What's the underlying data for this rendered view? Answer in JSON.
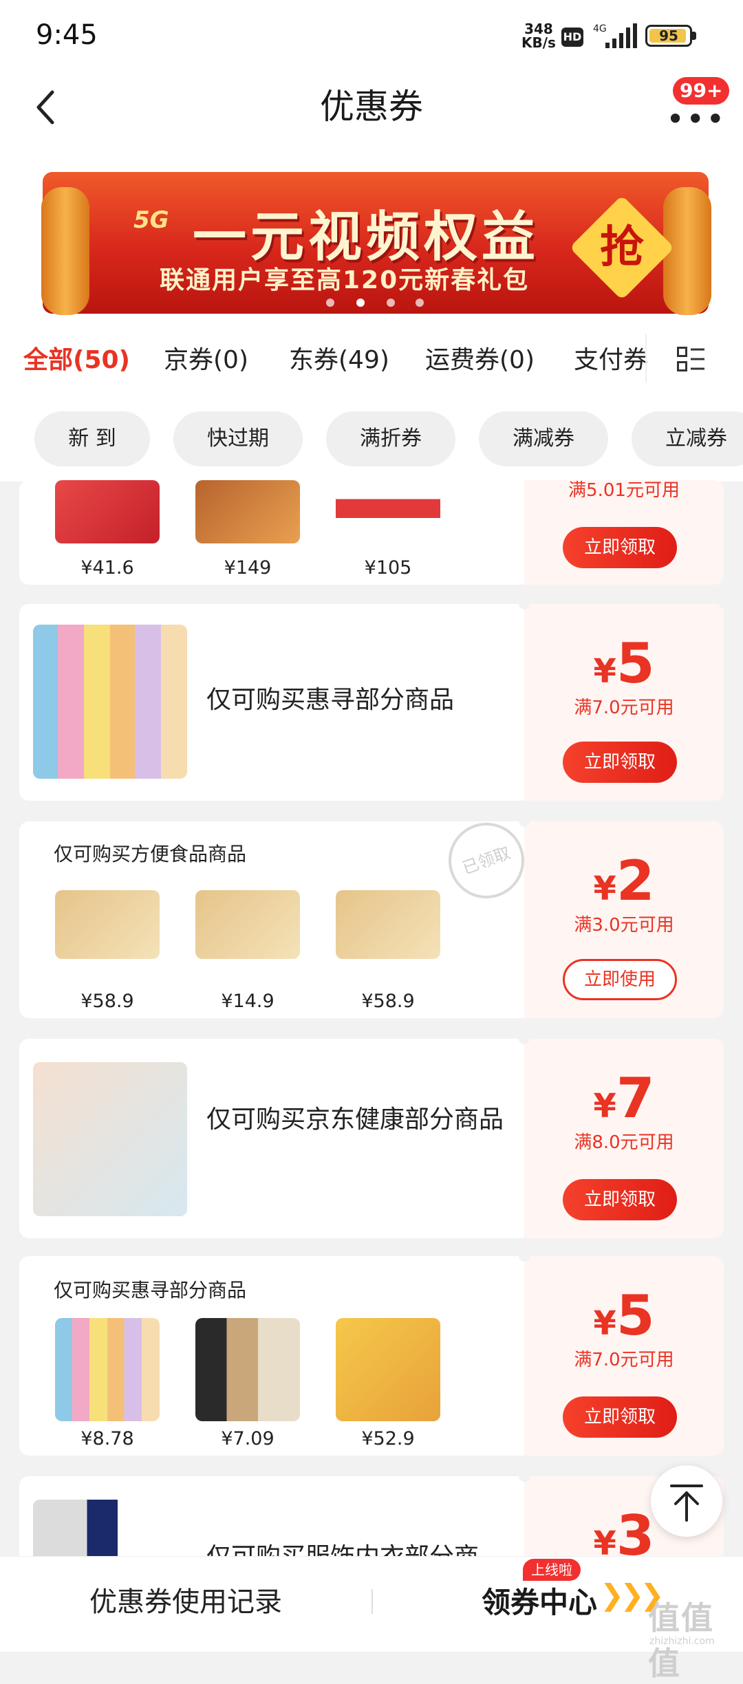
{
  "status": {
    "time": "9:45",
    "net_speed_value": "348",
    "net_speed_unit": "KB/s",
    "hd": "HD",
    "network": "4G",
    "battery": "95",
    "battery_level": 0.95
  },
  "header": {
    "title": "优惠券",
    "badge": "99+"
  },
  "banner": {
    "tag": "5G",
    "title": "一元视频权益",
    "subtitle": "联通用户享至高120元新春礼包",
    "grab": "抢",
    "dots_count": 4,
    "active_dot": 1
  },
  "tabs": [
    {
      "label": "全部(50)",
      "active": true
    },
    {
      "label": "京券(0)"
    },
    {
      "label": "东券(49)"
    },
    {
      "label": "运费券(0)"
    },
    {
      "label": "支付券"
    }
  ],
  "chips": [
    "新 到",
    "快过期",
    "满折券",
    "满减券",
    "立减券"
  ],
  "cards": [
    {
      "condition": "满5.01元可用",
      "button": "立即领取",
      "prices": [
        "¥41.6",
        "¥149",
        "¥105"
      ]
    },
    {
      "description": "仅可购买惠寻部分商品",
      "currency": "¥",
      "amount": "5",
      "condition": "满7.0元可用",
      "button": "立即领取"
    },
    {
      "title": "仅可购买方便食品商品",
      "currency": "¥",
      "amount": "2",
      "condition": "满3.0元可用",
      "button": "立即使用",
      "stamp": "已领取",
      "prices": [
        "¥58.9",
        "¥14.9",
        "¥58.9"
      ]
    },
    {
      "description": "仅可购买京东健康部分商品",
      "currency": "¥",
      "amount": "7",
      "condition": "满8.0元可用",
      "button": "立即领取"
    },
    {
      "title": "仅可购买惠寻部分商品",
      "currency": "¥",
      "amount": "5",
      "condition": "满7.0元可用",
      "button": "立即领取",
      "prices": [
        "¥8.78",
        "¥7.09",
        "¥52.9"
      ]
    },
    {
      "description": "仅可购买服饰内衣部分商",
      "currency": "¥",
      "amount": "3"
    }
  ],
  "bottom": {
    "record": "优惠券使用记录",
    "center": "领券中心",
    "arrows": "❯❯❯",
    "new_badge": "上线啦",
    "watermark": "值值值",
    "watermark_url": "zhizhizhi.com"
  }
}
